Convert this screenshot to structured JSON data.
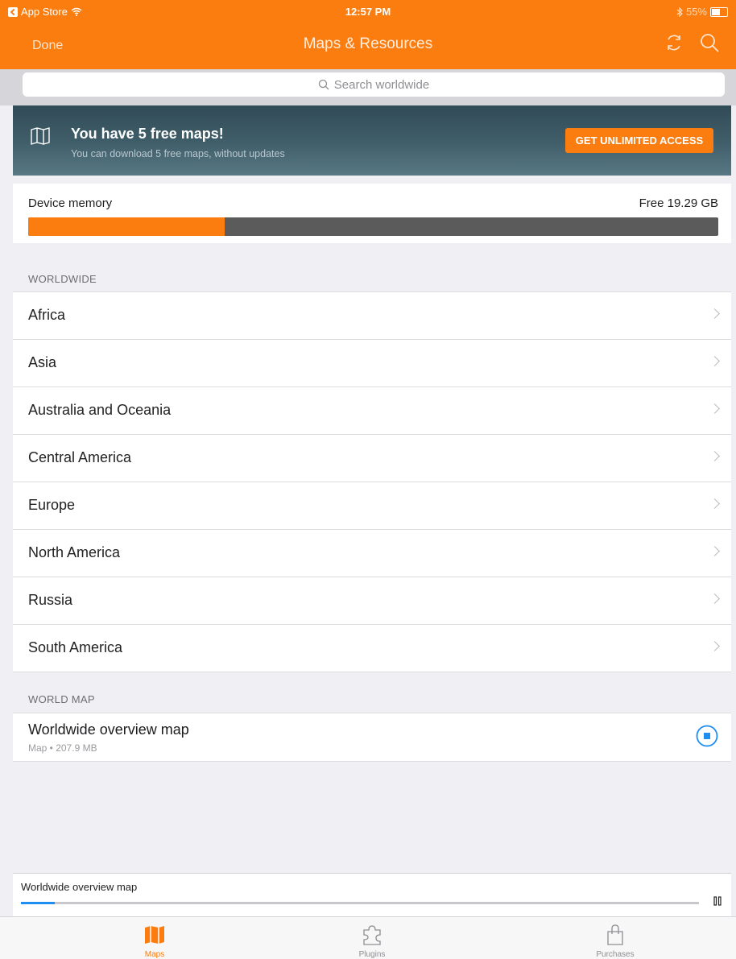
{
  "status_bar": {
    "back_app": "App Store",
    "time": "12:57 PM",
    "battery": "55%"
  },
  "nav": {
    "done_label": "Done",
    "title": "Maps & Resources"
  },
  "search": {
    "placeholder": "Search worldwide"
  },
  "banner": {
    "title": "You have 5 free maps!",
    "subtitle": "You can download 5 free maps, without updates",
    "cta_label": "GET UNLIMITED ACCESS"
  },
  "memory": {
    "label": "Device memory",
    "free": "Free 19.29 GB",
    "used_fraction": 0.285
  },
  "worldwide": {
    "header": "WORLDWIDE",
    "items": [
      {
        "label": "Africa"
      },
      {
        "label": "Asia"
      },
      {
        "label": "Australia and Oceania"
      },
      {
        "label": "Central America"
      },
      {
        "label": "Europe"
      },
      {
        "label": "North America"
      },
      {
        "label": "Russia"
      },
      {
        "label": "South America"
      }
    ]
  },
  "world_map": {
    "header": "WORLD MAP",
    "item": {
      "name": "Worldwide overview map",
      "meta": "Map • 207.9 MB"
    }
  },
  "download": {
    "name": "Worldwide overview map",
    "progress": 0.05
  },
  "tabs": [
    {
      "label": "Maps",
      "icon": "map-icon",
      "active": true
    },
    {
      "label": "Plugins",
      "icon": "puzzle-icon",
      "active": false
    },
    {
      "label": "Purchases",
      "icon": "shopping-bag-icon",
      "active": false
    }
  ],
  "colors": {
    "accent": "#fb7d10",
    "progress": "#1f8ef1",
    "banner": "#3f5d68"
  }
}
